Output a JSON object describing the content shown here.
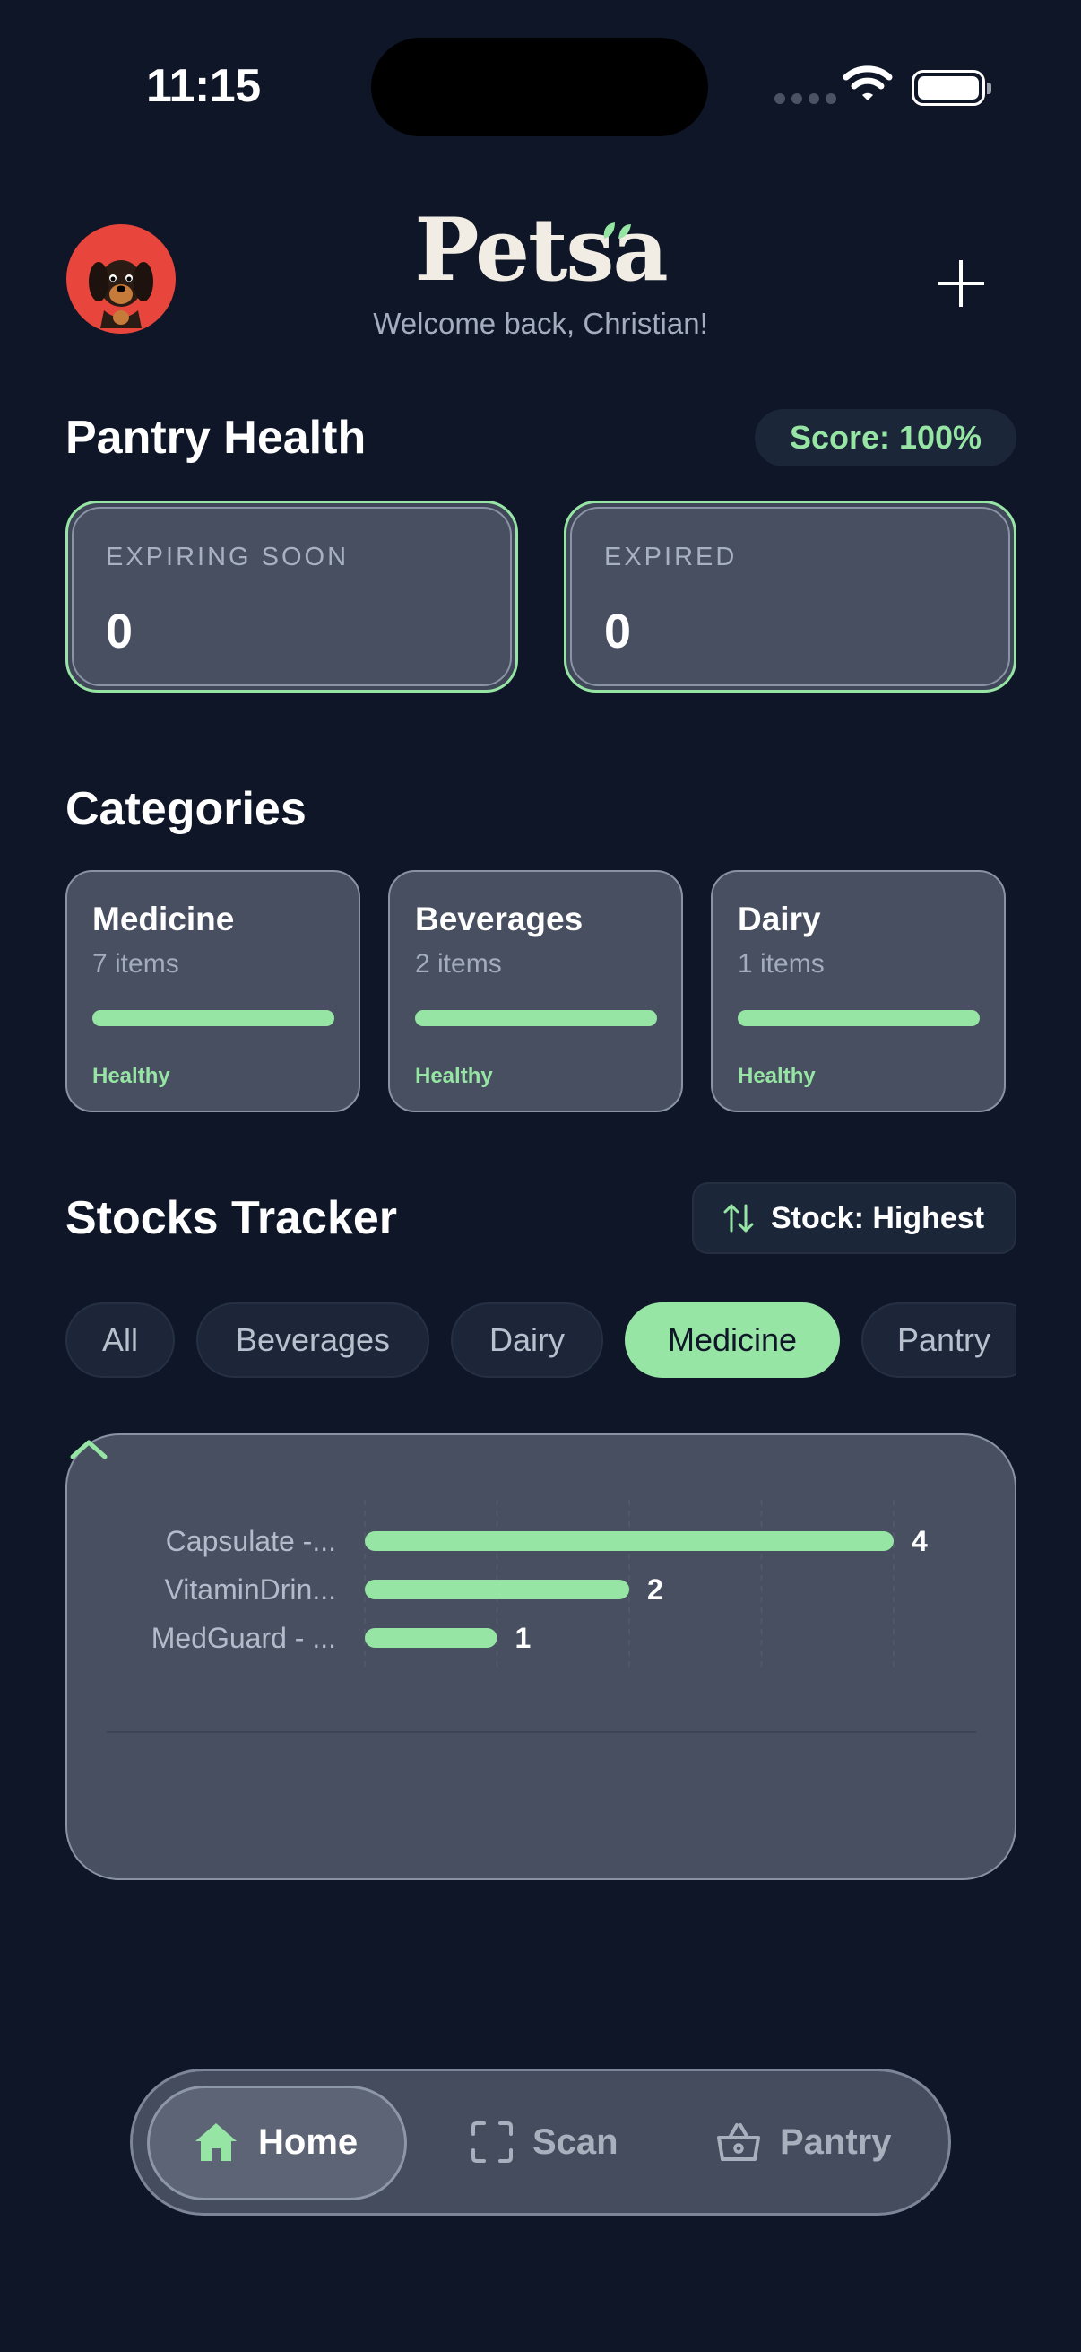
{
  "status_bar": {
    "time": "11:15"
  },
  "header": {
    "logo": "Petsa",
    "welcome": "Welcome back, Christian!"
  },
  "pantry_health": {
    "title": "Pantry Health",
    "score": "Score: 100%",
    "stats": [
      {
        "label": "EXPIRING SOON",
        "value": "0"
      },
      {
        "label": "EXPIRED",
        "value": "0"
      }
    ]
  },
  "categories": {
    "title": "Categories",
    "items": [
      {
        "name": "Medicine",
        "count": "7 items",
        "status": "Healthy",
        "health": 1.0
      },
      {
        "name": "Beverages",
        "count": "2 items",
        "status": "Healthy",
        "health": 1.0
      },
      {
        "name": "Dairy",
        "count": "1 items",
        "status": "Healthy",
        "health": 1.0
      }
    ]
  },
  "stocks": {
    "title": "Stocks Tracker",
    "sort_label": "Stock: Highest",
    "filters": [
      "All",
      "Beverages",
      "Dairy",
      "Medicine",
      "Pantry"
    ],
    "active_filter": "Medicine"
  },
  "chart_data": {
    "type": "bar",
    "orientation": "horizontal",
    "categories": [
      "Capsulate -...",
      "VitaminDrin...",
      "MedGuard - ..."
    ],
    "values": [
      4,
      2,
      1
    ],
    "xlim": [
      0,
      4
    ],
    "grid": true,
    "color": "#97e5a4"
  },
  "nav": {
    "items": [
      {
        "label": "Home",
        "icon": "home-icon",
        "active": true
      },
      {
        "label": "Scan",
        "icon": "scan-icon",
        "active": false
      },
      {
        "label": "Pantry",
        "icon": "basket-icon",
        "active": false
      }
    ]
  },
  "colors": {
    "accent": "#97e5a4",
    "background": "#0f1628",
    "card": "#474f61"
  }
}
